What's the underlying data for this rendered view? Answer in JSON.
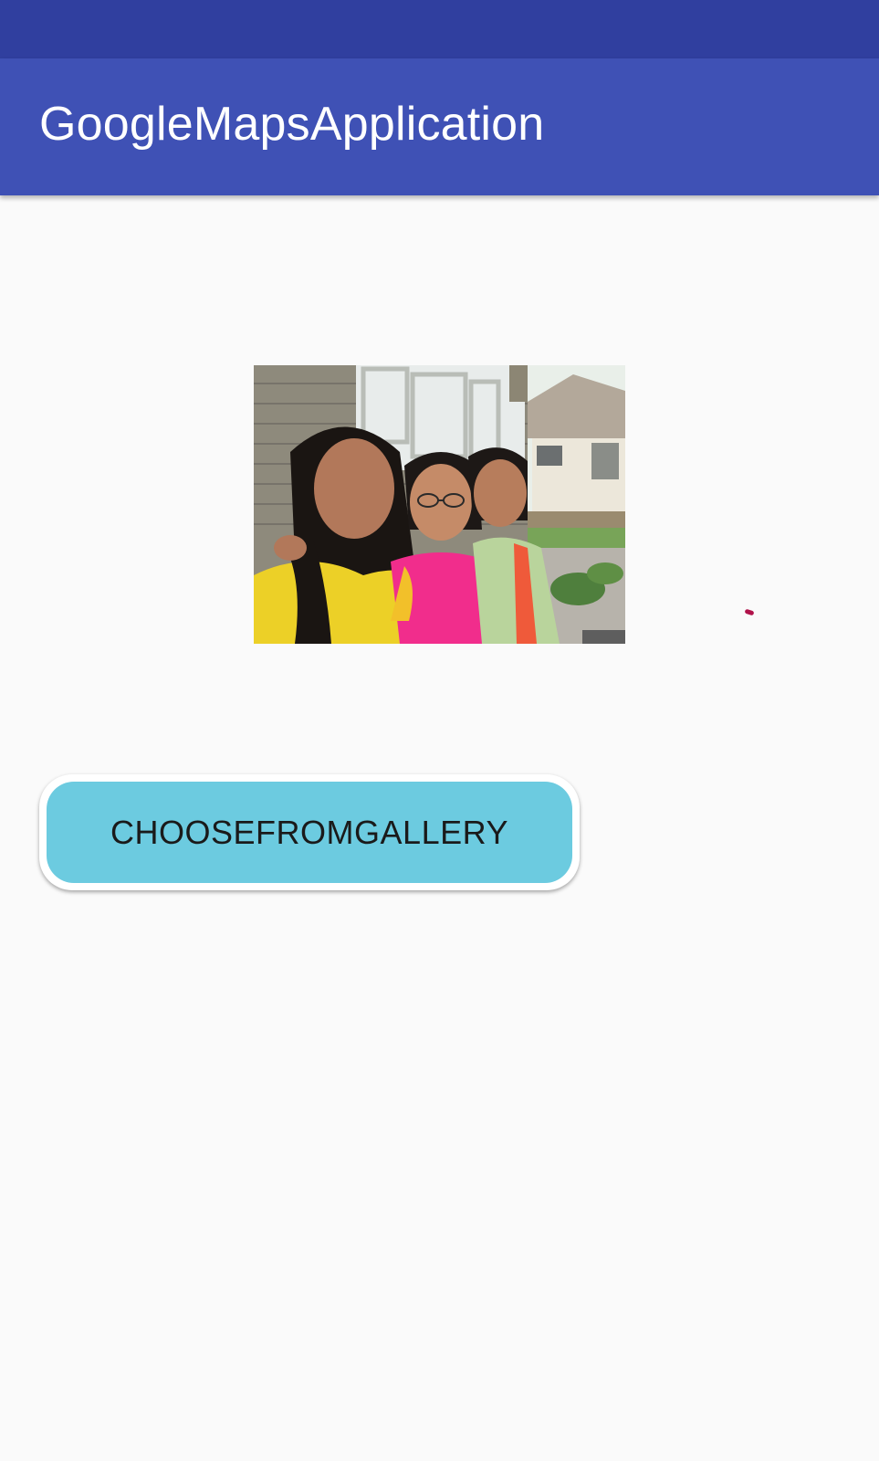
{
  "status_bar": {
    "color": "#303f9f"
  },
  "app_bar": {
    "title": "GoogleMapsApplication",
    "color": "#3f51b5",
    "title_color": "#ffffff"
  },
  "main": {
    "photo": {
      "alt": "Three women posing together in front of a house"
    },
    "choose_button": {
      "label": "CHOOSEFROMGALLERY",
      "color": "#6ccbe0"
    }
  }
}
